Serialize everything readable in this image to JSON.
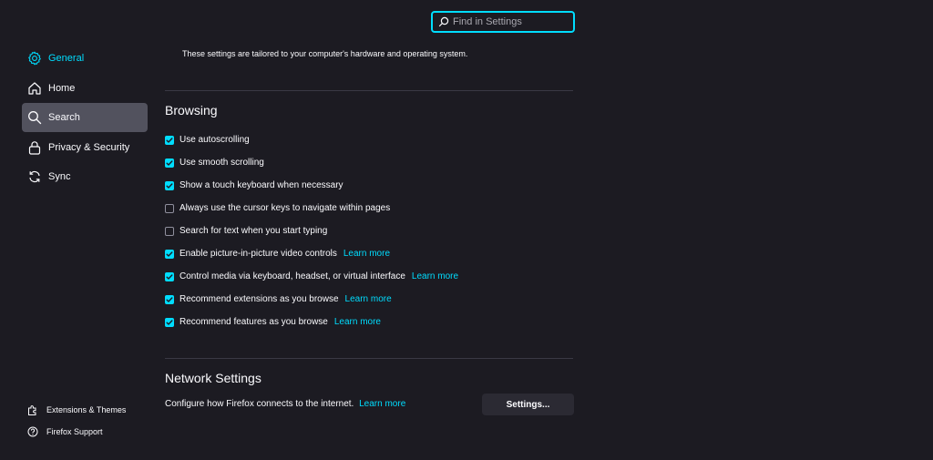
{
  "search": {
    "placeholder": "Find in Settings",
    "value": ""
  },
  "sidebar": {
    "items": [
      {
        "label": "General",
        "icon": "gear-icon",
        "state": "selected"
      },
      {
        "label": "Home",
        "icon": "home-icon",
        "state": ""
      },
      {
        "label": "Search",
        "icon": "search-icon",
        "state": "hovered"
      },
      {
        "label": "Privacy & Security",
        "icon": "lock-icon",
        "state": ""
      },
      {
        "label": "Sync",
        "icon": "sync-icon",
        "state": ""
      }
    ],
    "bottom": [
      {
        "label": "Extensions & Themes",
        "icon": "puzzle-icon"
      },
      {
        "label": "Firefox Support",
        "icon": "help-icon"
      }
    ]
  },
  "main": {
    "tailored_text": "These settings are tailored to your computer's hardware and operating system.",
    "browsing": {
      "title": "Browsing",
      "options": [
        {
          "label": "Use autoscrolling",
          "checked": true,
          "learn_more": ""
        },
        {
          "label": "Use smooth scrolling",
          "checked": true,
          "learn_more": ""
        },
        {
          "label": "Show a touch keyboard when necessary",
          "checked": true,
          "learn_more": ""
        },
        {
          "label": "Always use the cursor keys to navigate within pages",
          "checked": false,
          "learn_more": ""
        },
        {
          "label": "Search for text when you start typing",
          "checked": false,
          "learn_more": ""
        },
        {
          "label": "Enable picture-in-picture video controls",
          "checked": true,
          "learn_more": "Learn more"
        },
        {
          "label": "Control media via keyboard, headset, or virtual interface",
          "checked": true,
          "learn_more": "Learn more"
        },
        {
          "label": "Recommend extensions as you browse",
          "checked": true,
          "learn_more": "Learn more"
        },
        {
          "label": "Recommend features as you browse",
          "checked": true,
          "learn_more": "Learn more"
        }
      ]
    },
    "network": {
      "title": "Network Settings",
      "description": "Configure how Firefox connects to the internet.",
      "learn_more": "Learn more",
      "button_label": "Settings..."
    }
  },
  "colors": {
    "background": "#1c1b22",
    "accent": "#00ddff",
    "hover": "#52525e",
    "button": "#2b2a33",
    "text": "#fbfbfe"
  }
}
